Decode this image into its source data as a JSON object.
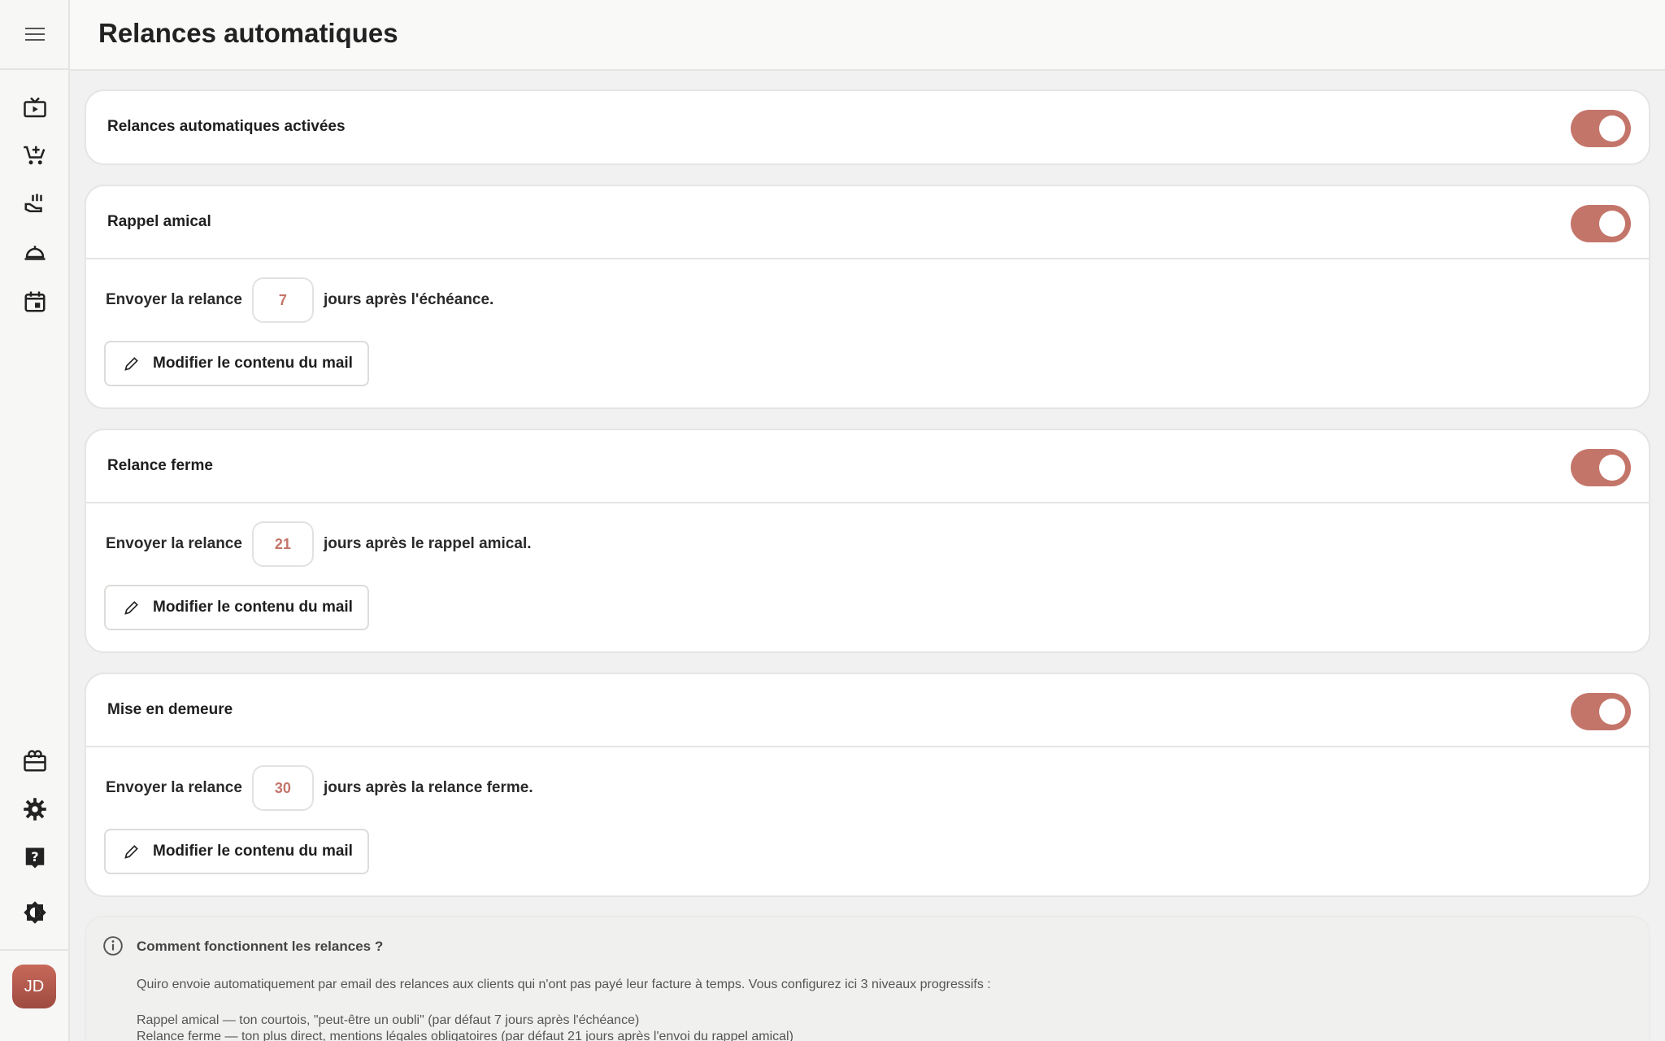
{
  "header": {
    "title": "Relances automatiques"
  },
  "sidebar": {
    "menu_icon": "hamburger-icon",
    "nav_icons": [
      "tv-play-icon",
      "cart-add-icon",
      "hand-coins-icon",
      "room-service-icon",
      "calendar-icon"
    ],
    "bottom_icons": [
      "gift-card-icon",
      "gear-icon",
      "help-icon",
      "theme-icon"
    ],
    "avatar": "JD"
  },
  "master": {
    "label": "Relances automatiques activées",
    "enabled": true
  },
  "levels": [
    {
      "title": "Rappel amical",
      "enabled": true,
      "send_label": "Envoyer la relance",
      "days": "7",
      "suffix": "jours après l'échéance.",
      "edit_label": "Modifier le contenu du mail"
    },
    {
      "title": "Relance ferme",
      "enabled": true,
      "send_label": "Envoyer la relance",
      "days": "21",
      "suffix": "jours après le rappel amical.",
      "edit_label": "Modifier le contenu du mail"
    },
    {
      "title": "Mise en demeure",
      "enabled": true,
      "send_label": "Envoyer la relance",
      "days": "30",
      "suffix": "jours après la relance ferme.",
      "edit_label": "Modifier le contenu du mail"
    }
  ],
  "info": {
    "title": "Comment fonctionnent les relances ?",
    "intro": "Quiro envoie automatiquement par email des relances aux clients qui n'ont pas payé leur facture à temps. Vous configurez ici 3 niveaux progressifs :",
    "line1": "Rappel amical — ton courtois, \"peut-être un oubli\" (par défaut 7 jours après l'échéance)",
    "line2": "Relance ferme — ton plus direct, mentions légales obligatoires (par défaut 21 jours après l'envoi du rappel amical)"
  },
  "colors": {
    "accent": "#c4756a",
    "border": "#e5e5e3",
    "background": "#f1f1f1"
  }
}
